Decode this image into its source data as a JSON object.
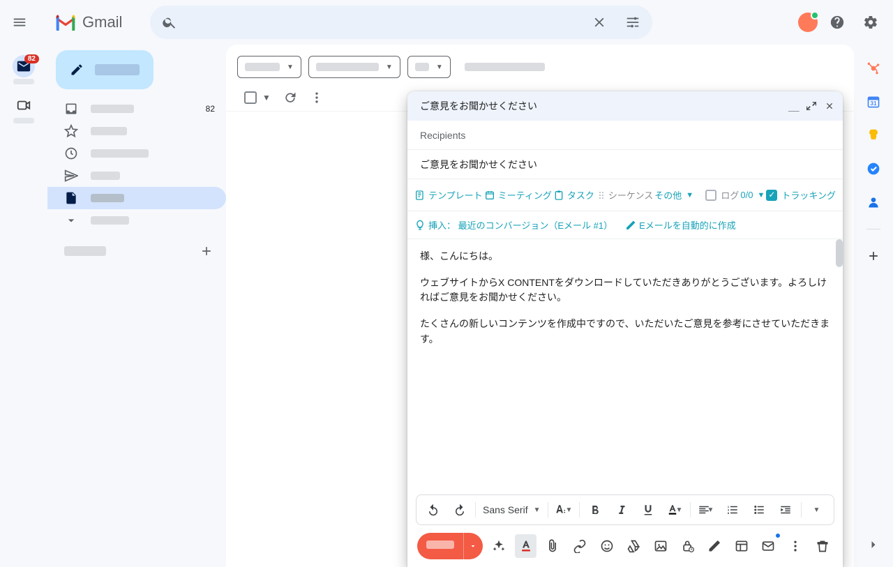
{
  "app_name": "Gmail",
  "rail": {
    "badge": "82"
  },
  "sidebar": {
    "inbox_count": "82"
  },
  "compose": {
    "title": "ご意見をお聞かせください",
    "recipients_placeholder": "Recipients",
    "subject": "ご意見をお聞かせください",
    "hs": {
      "templates": "テンプレート",
      "meetings": "ミーティング",
      "tasks": "タスク",
      "sequences": "シーケンス",
      "more": "その他",
      "log": "ログ",
      "count": "0/0",
      "tracking": "トラッキング",
      "insert_label": "挿入：",
      "insert_value": "最近のコンバージョン（Eメール #1）",
      "auto_email": "Eメールを自動的に作成"
    },
    "body": {
      "p1": "様、こんにちは。",
      "p2": "ウェブサイトからX CONTENTをダウンロードしていただきありがとうございます。よろしければご意見をお聞かせください。",
      "p3": "たくさんの新しいコンテンツを作成中ですので、いただいたご意見を参考にさせていただきます。"
    },
    "font": "Sans Serif"
  }
}
